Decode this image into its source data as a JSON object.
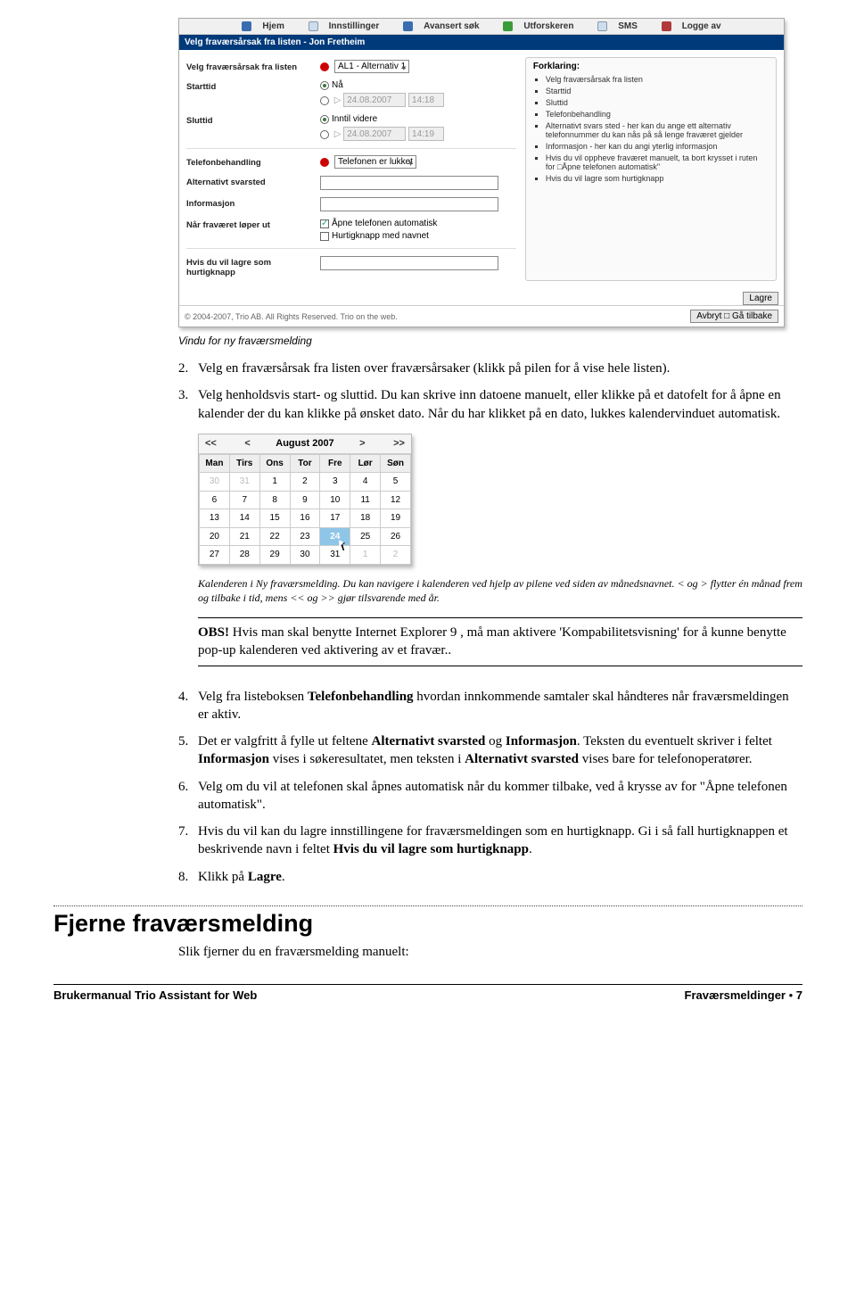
{
  "screenshot": {
    "nav": {
      "hjem": "Hjem",
      "innstillinger": "Innstillinger",
      "avansert_sok": "Avansert søk",
      "utforskeren": "Utforskeren",
      "sms": "SMS",
      "logge_av": "Logge av"
    },
    "title": "Velg fraværsårsak fra listen - Jon Fretheim",
    "form": {
      "reason_label": "Velg fraværsårsak fra listen",
      "reason_value": "AL1 - Alternativ 1",
      "start_label": "Starttid",
      "start_now": "Nå",
      "start_date": "24.08.2007",
      "start_time": "14:18",
      "end_label": "Sluttid",
      "end_until": "Inntil videre",
      "end_date": "24.08.2007",
      "end_time": "14:19",
      "phone_label": "Telefonbehandling",
      "phone_value": "Telefonen er lukket",
      "alt_label": "Alternativt svarsted",
      "info_label": "Informasjon",
      "expire_label": "Når fraværet løper ut",
      "cb_open": "Åpne telefonen automatisk",
      "cb_hotkey": "Hurtigknapp med navnet",
      "hotkey_label": "Hvis du vil lagre som hurtigknapp"
    },
    "help": {
      "title": "Forklaring:",
      "items": [
        "Velg fraværsårsak fra listen",
        "Starttid",
        "Sluttid",
        "Telefonbehandling",
        "Alternativt svars sted - her kan du ange ett alternativ telefonnummer du kan nås på så lenge fraværet gjelder",
        "Informasjon - her kan du angi yterlig informasjon",
        "Hvis du vil oppheve fraværet manuelt, ta bort krysset i ruten for □Åpne telefonen automatisk\"",
        "Hvis du vil lagre som hurtigknapp"
      ]
    },
    "footer_copy": "© 2004-2007, Trio AB. All Rights Reserved.   Trio on the web.",
    "btn_lagre": "Lagre",
    "btn_avbryt": "Avbryt □ Gå tilbake"
  },
  "caption1": "Vindu for ny fraværsmelding",
  "list2_num": "2.",
  "list2": "Velg en fraværsårsak fra listen over fraværsårsaker (klikk på pilen for å vise hele listen).",
  "list3_num": "3.",
  "list3": "Velg henholdsvis start- og sluttid. Du kan skrive inn datoene manuelt, eller klikke på et datofelt for å åpne en kalender der du kan klikke på ønsket dato. Når du har klikket på en dato, lukkes kalendervinduet automatisk.",
  "calendar": {
    "month": "August 2007",
    "nav_first": "<<",
    "nav_prev": "<",
    "nav_next": ">",
    "nav_last": ">>",
    "dow": [
      "Man",
      "Tirs",
      "Ons",
      "Tor",
      "Fre",
      "Lør",
      "Søn"
    ],
    "rows": [
      [
        {
          "d": "30",
          "o": true
        },
        {
          "d": "31",
          "o": true
        },
        {
          "d": "1"
        },
        {
          "d": "2"
        },
        {
          "d": "3"
        },
        {
          "d": "4"
        },
        {
          "d": "5"
        }
      ],
      [
        {
          "d": "6"
        },
        {
          "d": "7"
        },
        {
          "d": "8"
        },
        {
          "d": "9"
        },
        {
          "d": "10"
        },
        {
          "d": "11"
        },
        {
          "d": "12"
        }
      ],
      [
        {
          "d": "13"
        },
        {
          "d": "14"
        },
        {
          "d": "15"
        },
        {
          "d": "16"
        },
        {
          "d": "17"
        },
        {
          "d": "18"
        },
        {
          "d": "19"
        }
      ],
      [
        {
          "d": "20"
        },
        {
          "d": "21"
        },
        {
          "d": "22"
        },
        {
          "d": "23"
        },
        {
          "d": "24",
          "sel": true
        },
        {
          "d": "25"
        },
        {
          "d": "26"
        }
      ],
      [
        {
          "d": "27"
        },
        {
          "d": "28"
        },
        {
          "d": "29"
        },
        {
          "d": "30"
        },
        {
          "d": "31"
        },
        {
          "d": "1",
          "o": true
        },
        {
          "d": "2",
          "o": true
        }
      ]
    ]
  },
  "caption2": "Kalenderen i Ny fraværsmelding. Du kan navigere i kalenderen ved hjelp av pilene ved siden av månedsnavnet. < og > flytter én månad frem og tilbake i tid, mens << og >> gjør tilsvarende med år.",
  "obs_label": "OBS!",
  "obs_text": " Hvis man skal benytte Internet Explorer 9 , må man aktivere 'Kompabilitetsvisning' for å kunne benytte pop-up kalenderen ved aktivering av et fravær..",
  "list4_num": "4.",
  "list4a": "Velg fra listeboksen ",
  "list4b": "Telefonbehandling",
  "list4c": " hvordan innkommende samtaler skal håndteres når fraværsmeldingen er aktiv.",
  "list5_num": "5.",
  "list5a": "Det er valgfritt å fylle ut feltene ",
  "list5b": "Alternativt svarsted",
  "list5c": " og ",
  "list5d": "Informasjon",
  "list5e": ". Teksten du eventuelt skriver i feltet ",
  "list5f": "Informasjon",
  "list5g": " vises i søkeresultatet, men teksten i ",
  "list5h": "Alternativt svarsted",
  "list5i": " vises bare for telefonoperatører.",
  "list6_num": "6.",
  "list6": "Velg om du vil at telefonen skal åpnes automatisk når du kommer tilbake, ved å krysse av for \"Åpne telefonen automatisk\".",
  "list7_num": "7.",
  "list7a": "Hvis du vil kan du lagre innstillingene for fraværsmeldingen som en hurtigknapp. Gi i så fall hurtigknappen et beskrivende navn i feltet ",
  "list7b": "Hvis du vil lagre som hurtigknapp",
  "list7c": ".",
  "list8_num": "8.",
  "list8a": "Klikk på ",
  "list8b": "Lagre",
  "list8c": ".",
  "section_title": "Fjerne fraværsmelding",
  "section_intro": "Slik fjerner du en fraværsmelding manuelt:",
  "footer_left": "Brukermanual Trio Assistant for Web",
  "footer_right_a": "Fraværsmeldinger",
  "footer_right_b": " • ",
  "footer_right_c": "7"
}
